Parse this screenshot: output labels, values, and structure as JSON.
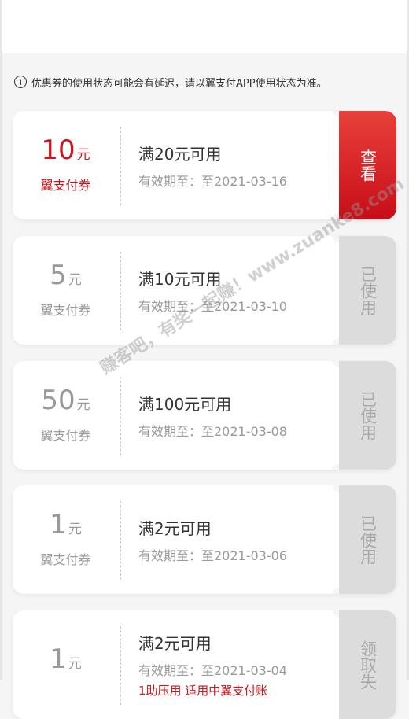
{
  "notice": {
    "icon": "info-icon",
    "text": "优惠券的使用状态可能会有延迟，请以翼支付APP使用状态为准。"
  },
  "coupons": [
    {
      "amount": "10",
      "unit": "元",
      "type_label": "翼支付券",
      "condition": "满20元可用",
      "expiry": "有效期至：至2021-03-16",
      "action": "查看",
      "status": "active"
    },
    {
      "amount": "5",
      "unit": "元",
      "type_label": "翼支付券",
      "condition": "满10元可用",
      "expiry": "有效期至：至2021-03-10",
      "action": "已使用",
      "status": "used"
    },
    {
      "amount": "50",
      "unit": "元",
      "type_label": "翼支付券",
      "condition": "满100元可用",
      "expiry": "有效期至：至2021-03-08",
      "action": "已使用",
      "status": "used"
    },
    {
      "amount": "1",
      "unit": "元",
      "type_label": "翼支付券",
      "condition": "满2元可用",
      "expiry": "有效期至：至2021-03-06",
      "action": "已使用",
      "status": "used"
    },
    {
      "amount": "1",
      "unit": "元",
      "type_label": "",
      "condition": "满2元可用",
      "expiry": "有效期至：至2021-03-04",
      "note": "1助压用 适用中翼支付账",
      "action": "领取失",
      "status": "used"
    }
  ],
  "watermark": "赚客吧，有奖一起赚！www.zuanke8.com",
  "colors": {
    "accent_red": "#c8161e",
    "used_gray": "#9a9a9a",
    "page_bg": "#f5f5f5"
  }
}
